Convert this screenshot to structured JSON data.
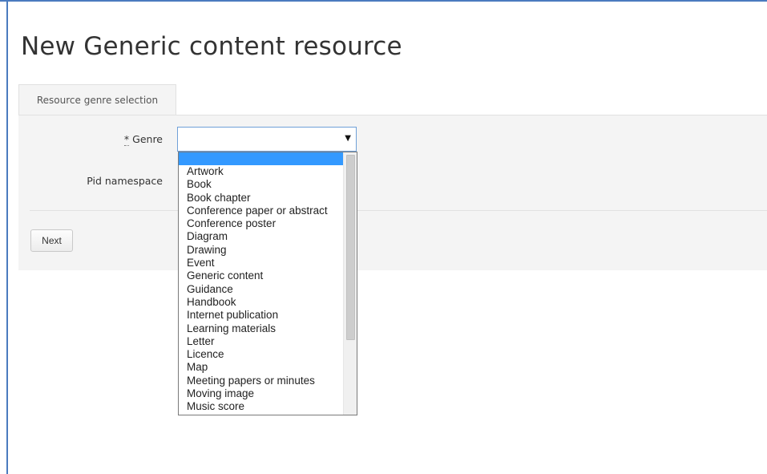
{
  "page": {
    "title": "New Generic content resource"
  },
  "tabs": [
    {
      "label": "Resource genre selection"
    }
  ],
  "form": {
    "genre_required_mark": "*",
    "genre_label": "Genre",
    "pid_namespace_label": "Pid namespace",
    "next_label": "Next",
    "genre_value": ""
  },
  "genre_dropdown": {
    "arrow": "▼",
    "options": [
      "",
      "Artwork",
      "Book",
      "Book chapter",
      "Conference paper or abstract",
      "Conference poster",
      "Diagram",
      "Drawing",
      "Event",
      "Generic content",
      "Guidance",
      "Handbook",
      "Internet publication",
      "Learning materials",
      "Letter",
      "Licence",
      "Map",
      "Meeting papers or minutes",
      "Moving image",
      "Music score"
    ],
    "highlight_color": "#3399ff"
  }
}
